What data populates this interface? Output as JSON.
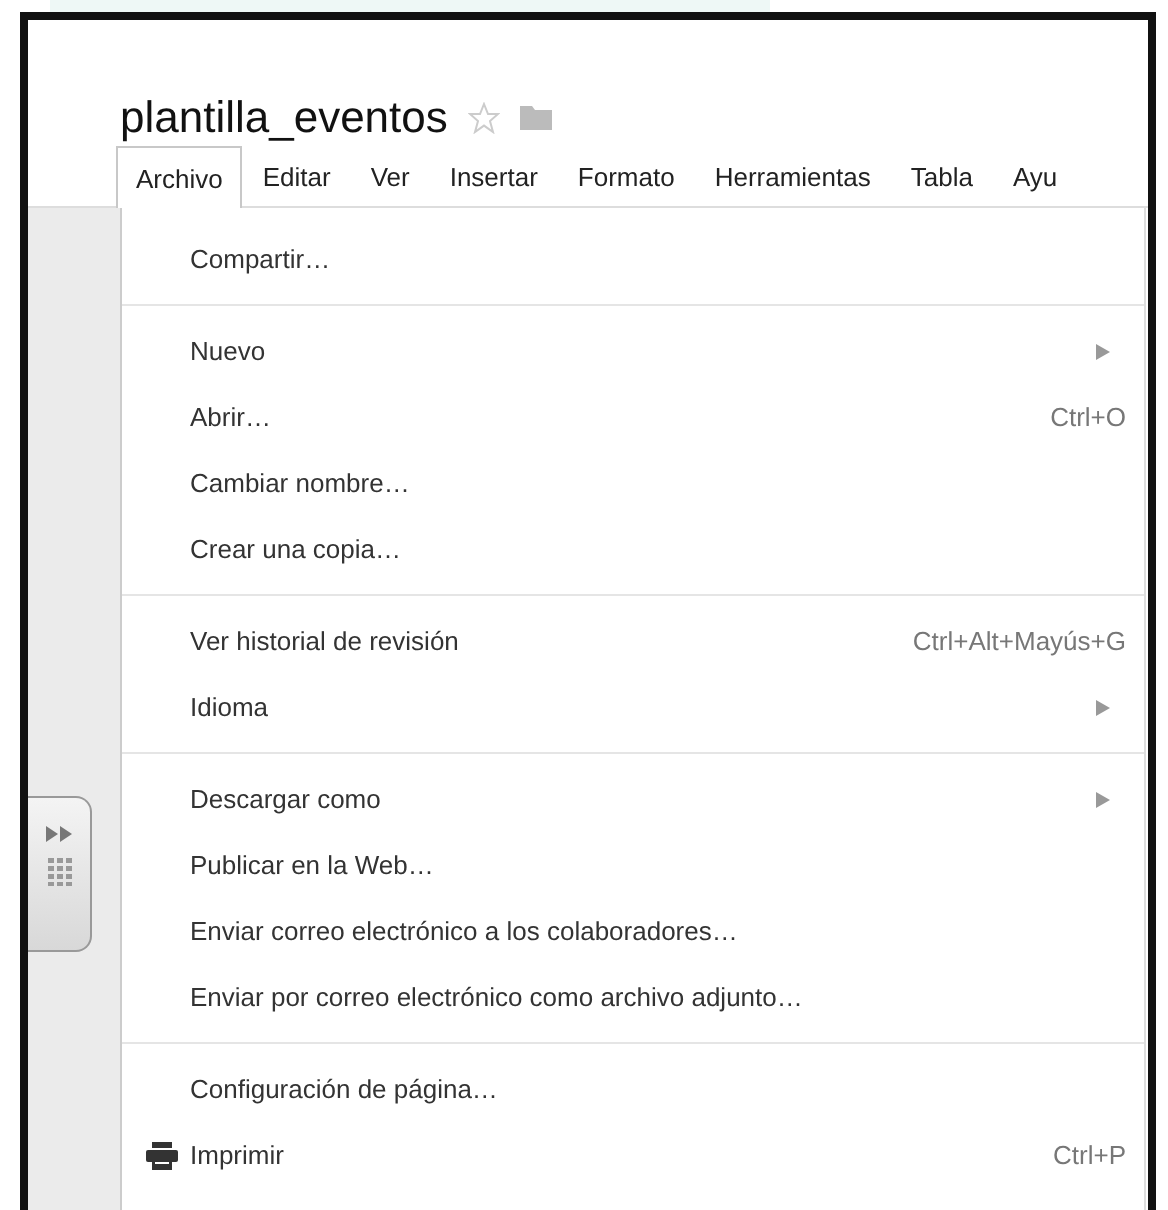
{
  "document": {
    "title": "plantilla_eventos",
    "starred": false
  },
  "menu_bar": [
    {
      "label": "Archivo",
      "selected": true
    },
    {
      "label": "Editar",
      "selected": false
    },
    {
      "label": "Ver",
      "selected": false
    },
    {
      "label": "Insertar",
      "selected": false
    },
    {
      "label": "Formato",
      "selected": false
    },
    {
      "label": "Herramientas",
      "selected": false
    },
    {
      "label": "Tabla",
      "selected": false
    },
    {
      "label": "Ayu",
      "selected": false
    }
  ],
  "menu": {
    "groups": [
      [
        {
          "kind": "command",
          "label": "Compartir…"
        }
      ],
      [
        {
          "kind": "submenu",
          "label": "Nuevo"
        },
        {
          "kind": "command",
          "label": "Abrir…",
          "shortcut": "Ctrl+O"
        },
        {
          "kind": "command",
          "label": "Cambiar nombre…"
        },
        {
          "kind": "command",
          "label": "Crear una copia…"
        }
      ],
      [
        {
          "kind": "command",
          "label": "Ver historial de revisión",
          "shortcut": "Ctrl+Alt+Mayús+G"
        },
        {
          "kind": "submenu",
          "label": "Idioma"
        }
      ],
      [
        {
          "kind": "submenu",
          "label": "Descargar como"
        },
        {
          "kind": "command",
          "label": "Publicar en la Web…"
        },
        {
          "kind": "command",
          "label": "Enviar correo electrónico a los colaboradores…"
        },
        {
          "kind": "command",
          "label": "Enviar por correo electrónico como archivo adjunto…"
        }
      ],
      [
        {
          "kind": "command",
          "label": "Configuración de página…"
        },
        {
          "kind": "print",
          "label": "Imprimir",
          "shortcut": "Ctrl+P"
        }
      ]
    ]
  }
}
